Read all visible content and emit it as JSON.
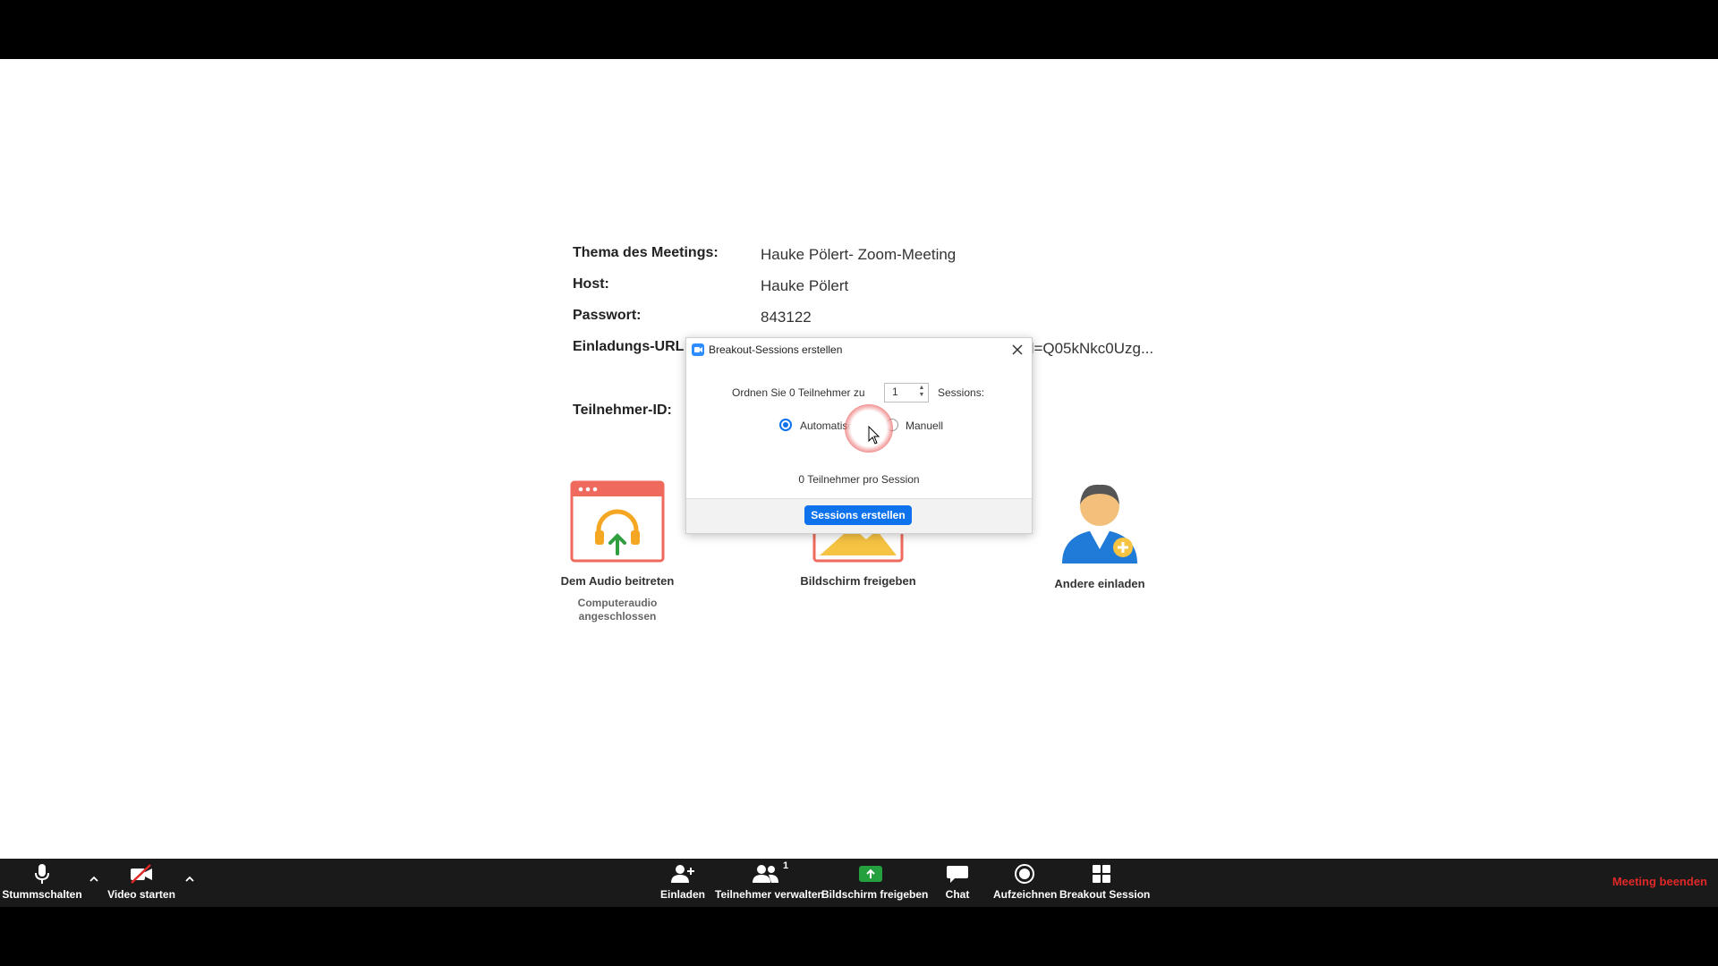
{
  "meeting": {
    "topic_label": "Thema des Meetings:",
    "topic_value": "Hauke Pölert- Zoom-Meeting",
    "host_label": "Host:",
    "host_value": "Hauke Pölert",
    "password_label": "Passwort:",
    "password_value": "843122",
    "url_label": "Einladungs-URL:",
    "url_value_visible": "d=Q05kNkc0Uzg...",
    "participant_id_label": "Teilnehmer-ID:"
  },
  "actions": {
    "audio_label": "Dem Audio beitreten",
    "audio_sub": "Computeraudio angeschlossen",
    "share_label": "Bildschirm freigeben",
    "invite_label": "Andere einladen"
  },
  "dialog": {
    "title": "Breakout-Sessions erstellen",
    "assign_prefix": "Ordnen Sie 0 Teilnehmer zu",
    "session_count": "1",
    "assign_suffix": "Sessions:",
    "option_auto": "Automatisch",
    "option_manual": "Manuell",
    "selected": "Automatisch",
    "per_session": "0 Teilnehmer pro Session",
    "create_button": "Sessions erstellen"
  },
  "toolbar": {
    "mute": "Stummschalten",
    "video": "Video starten",
    "invite": "Einladen",
    "participants": "Teilnehmer verwalten",
    "participants_count": "1",
    "share": "Bildschirm freigeben",
    "chat": "Chat",
    "record": "Aufzeichnen",
    "breakout": "Breakout Session",
    "end": "Meeting beenden"
  },
  "colors": {
    "accent": "#0e72ed",
    "share_green": "#24a03f",
    "end_red": "#e02828",
    "audio_card": "#ef6a5c"
  }
}
